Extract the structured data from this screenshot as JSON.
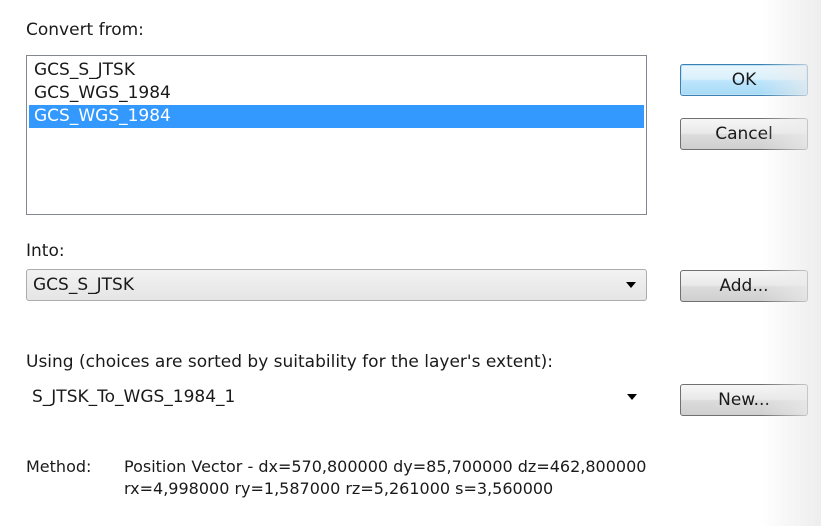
{
  "convert_from": {
    "label": "Convert from:",
    "items": [
      {
        "label": "GCS_S_JTSK",
        "selected": false
      },
      {
        "label": "GCS_WGS_1984",
        "selected": false
      },
      {
        "label": "GCS_WGS_1984",
        "selected": true
      }
    ]
  },
  "into": {
    "label": "Into:",
    "selected_value": "GCS_S_JTSK"
  },
  "using": {
    "label": "Using (choices are sorted by suitability for the layer's extent):",
    "selected_value": "S_JTSK_To_WGS_1984_1"
  },
  "buttons": {
    "ok": "OK",
    "cancel": "Cancel",
    "add": "Add...",
    "new": "New..."
  },
  "method": {
    "key": "Method:",
    "line1": "Position Vector - dx=570,800000 dy=85,700000 dz=462,800000",
    "line2": "rx=4,998000 ry=1,587000 rz=5,261000 s=3,560000"
  },
  "icons": {
    "dropdown": "chevron-down-icon"
  }
}
